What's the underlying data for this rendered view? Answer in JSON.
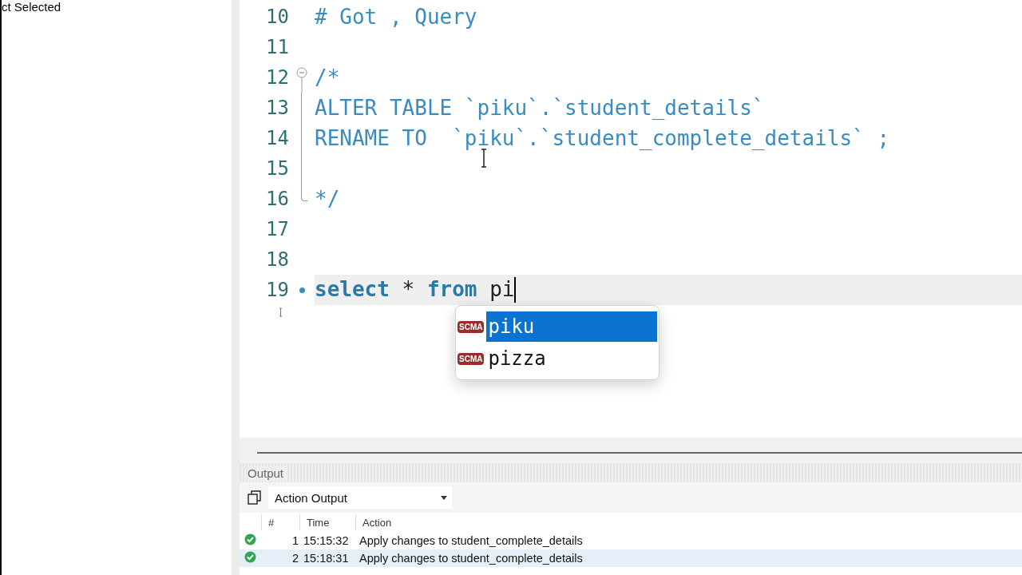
{
  "left_panel": {
    "text": "ct Selected"
  },
  "editor": {
    "lines": [
      {
        "number": "10",
        "kind": "plain",
        "tokens": [
          {
            "text": "# Got , Query",
            "kind": "comment"
          }
        ]
      },
      {
        "number": "11",
        "kind": "plain"
      },
      {
        "number": "12",
        "kind": "fold_start",
        "tokens": [
          {
            "text": "/*",
            "kind": "comment"
          }
        ]
      },
      {
        "number": "13",
        "kind": "fold_inside",
        "tokens": [
          {
            "text": "ALTER TABLE `piku`.`student_details`",
            "kind": "comment"
          }
        ]
      },
      {
        "number": "14",
        "kind": "fold_inside",
        "tokens": [
          {
            "text": "RENAME TO  `piku`.`student_complete_details` ;",
            "kind": "comment"
          }
        ]
      },
      {
        "number": "15",
        "kind": "fold_inside"
      },
      {
        "number": "16",
        "kind": "fold_end",
        "tokens": [
          {
            "text": "*/",
            "kind": "comment"
          }
        ]
      },
      {
        "number": "17",
        "kind": "plain"
      },
      {
        "number": "18",
        "kind": "plain"
      },
      {
        "number": "19",
        "kind": "plain",
        "current": true,
        "tokens": [
          {
            "text": "select",
            "kind": "keyword"
          },
          {
            "text": " * ",
            "kind": "text"
          },
          {
            "text": "from",
            "kind": "keyword"
          },
          {
            "text": " pi",
            "kind": "text"
          }
        ]
      }
    ],
    "autocomplete": [
      {
        "badge": "SCMA",
        "text": "piku",
        "selected": true
      },
      {
        "badge": "SCMA",
        "text": "pizza",
        "selected": false
      }
    ]
  },
  "output": {
    "title": "Output",
    "selector": "Action Output",
    "columns": [
      "#",
      "Time",
      "Action"
    ],
    "rows": [
      {
        "kind": "success",
        "number": "1",
        "time": "15:15:32",
        "action": "Apply changes to student_complete_details",
        "selected": false
      },
      {
        "kind": "success",
        "number": "2",
        "time": "15:18:31",
        "action": "Apply changes to student_complete_details",
        "selected": true
      }
    ]
  }
}
